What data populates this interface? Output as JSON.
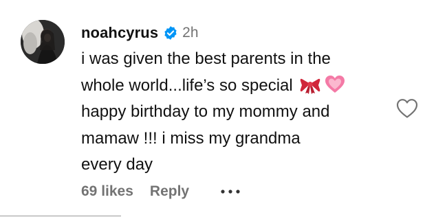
{
  "comment": {
    "username": "noahcyrus",
    "time": "2h",
    "lines": [
      "i was given the best parents in the",
      "whole world...life’s so special",
      "happy birthday to my mommy and",
      "mamaw !!! i miss my grandma",
      "every day"
    ],
    "emojis": [
      "ribbon-emoji",
      "pink-heart-emoji"
    ],
    "likes": "69 likes",
    "reply_label": "Reply"
  },
  "icons": {
    "verified": "verified-badge-icon",
    "like": "heart-outline-icon",
    "more": "more-options-icon"
  },
  "colors": {
    "verified_blue": "#0095f6",
    "secondary_text": "#737373",
    "primary_text": "#111111",
    "ribbon_red": "#d0263a",
    "heart_pink": "#f47aa6"
  }
}
